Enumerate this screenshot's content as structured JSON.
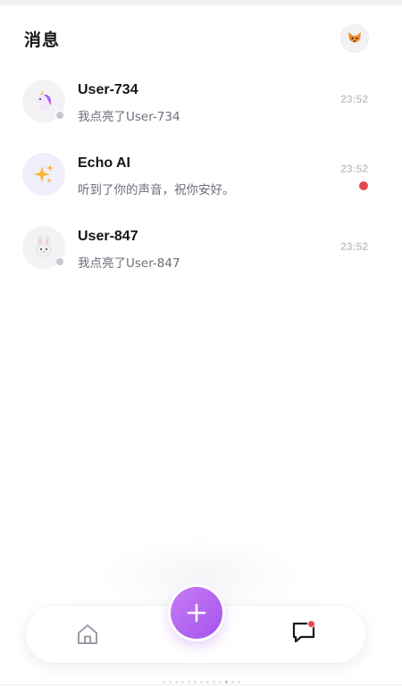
{
  "header": {
    "title": "消息",
    "avatar_icon": "fox-emoji-icon"
  },
  "conversations": [
    {
      "name": "User-734",
      "preview": "我点亮了User-734",
      "time": "23:52",
      "avatar_icon": "unicorn-emoji-icon",
      "online": false,
      "unread": false
    },
    {
      "name": "Echo AI",
      "preview": "听到了你的声音，祝你安好。",
      "time": "23:52",
      "avatar_icon": "sparkles-emoji-icon",
      "online": null,
      "unread": true
    },
    {
      "name": "User-847",
      "preview": "我点亮了User-847",
      "time": "23:52",
      "avatar_icon": "rabbit-emoji-icon",
      "online": false,
      "unread": false
    }
  ],
  "bottom_nav": {
    "items": [
      {
        "name": "home",
        "icon": "home-icon",
        "active": false
      },
      {
        "name": "messages",
        "icon": "message-icon",
        "active": true,
        "badge": true
      }
    ],
    "fab_icon": "plus-icon"
  },
  "colors": {
    "accent": "#b366f0",
    "unread": "#e5484d",
    "title": "#17181c",
    "preview": "#6c6e78",
    "time": "#c7c8ce"
  }
}
